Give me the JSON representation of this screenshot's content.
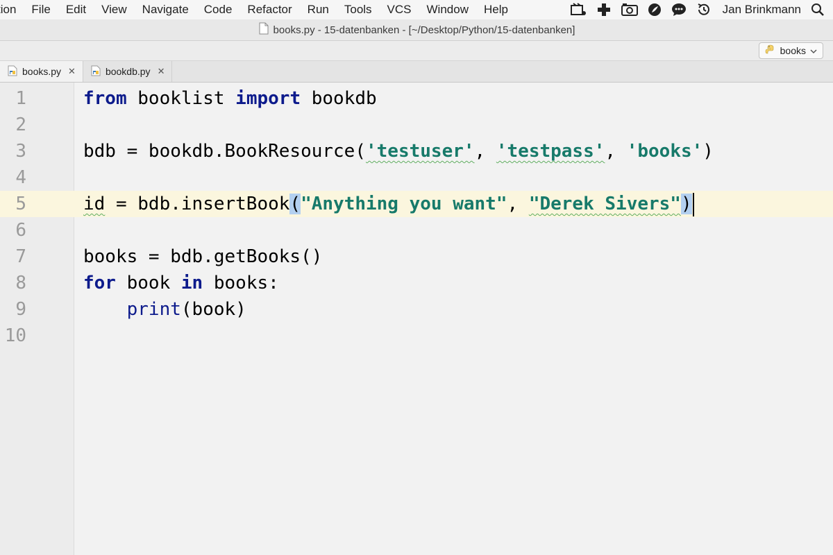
{
  "menubar": {
    "items": [
      "tion",
      "File",
      "Edit",
      "View",
      "Navigate",
      "Code",
      "Refactor",
      "Run",
      "Tools",
      "VCS",
      "Window",
      "Help"
    ],
    "user": "Jan Brinkmann"
  },
  "window": {
    "title": "books.py - 15-datenbanken - [~/Desktop/Python/15-datenbanken]"
  },
  "navbar": {
    "run_config": "books"
  },
  "tabs": [
    {
      "label": "books.py",
      "active": true
    },
    {
      "label": "bookdb.py",
      "active": false
    }
  ],
  "editor": {
    "current_line": 5,
    "line_numbers": [
      "1",
      "2",
      "3",
      "4",
      "5",
      "6",
      "7",
      "8",
      "9",
      "10"
    ],
    "lines": {
      "l1": {
        "t1": "from",
        "t2": " booklist ",
        "t3": "import",
        "t4": " bookdb"
      },
      "l3": {
        "t1": "bdb = bookdb.BookResource(",
        "s1": "'testuser'",
        "t2": ", ",
        "s2": "'testpass'",
        "t3": ", ",
        "s3": "'books'",
        "t4": ")"
      },
      "l5": {
        "t1": "id",
        "t2": " = bdb.insertBook",
        "t3": "(",
        "s1": "\"Anything you want\"",
        "t4": ", ",
        "s2": "\"Derek Sivers\"",
        "t5": ")"
      },
      "l7": {
        "t1": "books = bdb.getBooks()"
      },
      "l8": {
        "t1": "for",
        "t2": " book ",
        "t3": "in",
        "t4": " books:"
      },
      "l9": {
        "t1": "    ",
        "t2": "print",
        "t3": "(book)"
      }
    }
  },
  "colors": {
    "keyword": "#0d1b8c",
    "string": "#177a6a",
    "current_line": "#fbf6de",
    "brace_match": "#b3d0f0"
  }
}
